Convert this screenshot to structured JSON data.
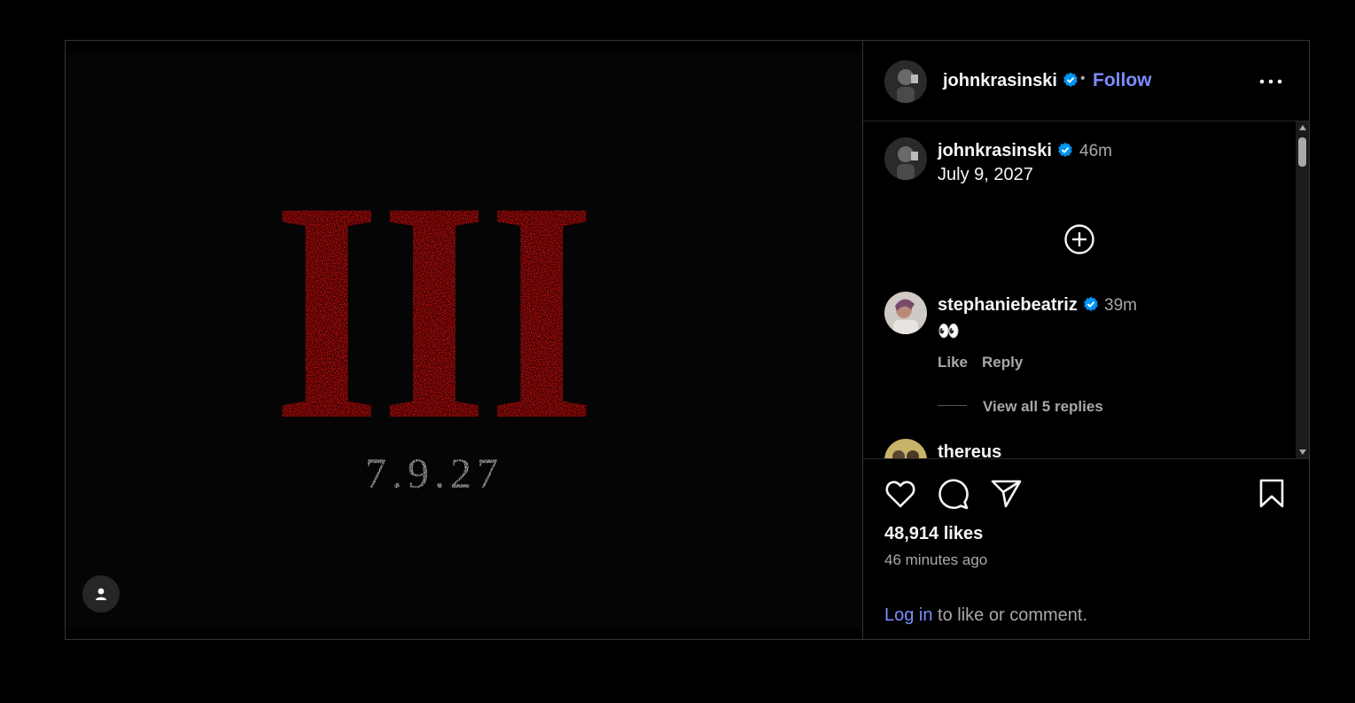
{
  "post": {
    "username": "johnkrasinski",
    "separator": "•",
    "follow_label": "Follow",
    "poster": {
      "numeral": "III",
      "date": "7.9.27"
    }
  },
  "comments": [
    {
      "username": "johnkrasinski",
      "time": "46m",
      "text": "July 9, 2027"
    },
    {
      "username": "stephaniebeatriz",
      "time": "39m",
      "text": "👀",
      "like_label": "Like",
      "reply_label": "Reply",
      "replies_label": "View all 5 replies"
    },
    {
      "username": "thereus"
    }
  ],
  "actions": {
    "likes": "48,914 likes",
    "time_ago": "46 minutes ago",
    "login_link": "Log in",
    "login_rest": " to like or comment."
  },
  "colors": {
    "accent": "#7b8cff",
    "verified": "#0095f6",
    "poster_red": "#e30b0b"
  },
  "icons": [
    "verified-badge-icon",
    "more-options-icon",
    "add-comment-icon",
    "heart-icon",
    "comment-icon",
    "share-icon",
    "bookmark-icon",
    "user-tag-icon"
  ]
}
